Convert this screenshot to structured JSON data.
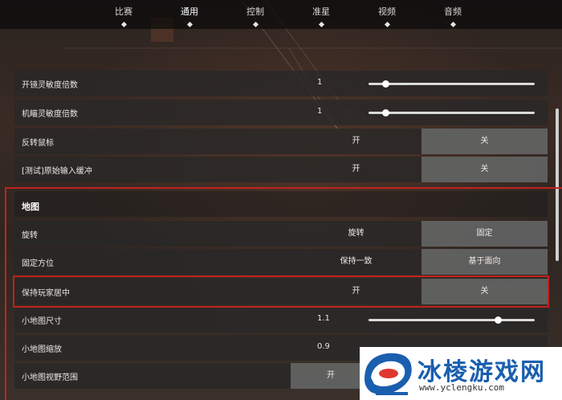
{
  "tabs": [
    {
      "label": "比赛"
    },
    {
      "label": "通用",
      "active": true
    },
    {
      "label": "控制"
    },
    {
      "label": "准星"
    },
    {
      "label": "视频"
    },
    {
      "label": "音频"
    }
  ],
  "rows": {
    "scope_sens": {
      "label": "开镜灵敏度倍数",
      "value": "1",
      "slider_fraction": 0.1
    },
    "aim_sens": {
      "label": "机瞄灵敏度倍数",
      "value": "1",
      "slider_fraction": 0.1
    },
    "invert_mouse": {
      "label": "反转鼠标",
      "opt_a": "开",
      "opt_b": "关"
    },
    "raw_input": {
      "label": "[测试]原始输入缓冲",
      "opt_a": "开",
      "opt_b": "关"
    }
  },
  "map_section": {
    "title": "地图",
    "rotate": {
      "label": "旋转",
      "opt_a": "旋转",
      "opt_b": "固定"
    },
    "fixed_dir": {
      "label": "固定方位",
      "opt_a": "保持一致",
      "opt_b": "基于面向"
    },
    "keep_center": {
      "label": "保持玩家居中",
      "opt_a": "开",
      "opt_b": "关"
    },
    "minimap_size": {
      "label": "小地图尺寸",
      "value": "1.1",
      "slider_fraction": 0.78
    },
    "minimap_zoom": {
      "label": "小地图缩放",
      "value": "0.9"
    },
    "minimap_view": {
      "label": "小地图视野范围",
      "opt_a": "开"
    }
  },
  "watermark": {
    "brand": "冰棱游戏网",
    "url": "www.yclengku.com"
  },
  "colors": {
    "highlight_red": "#c0231f",
    "brand_blue": "#1a5fae"
  }
}
